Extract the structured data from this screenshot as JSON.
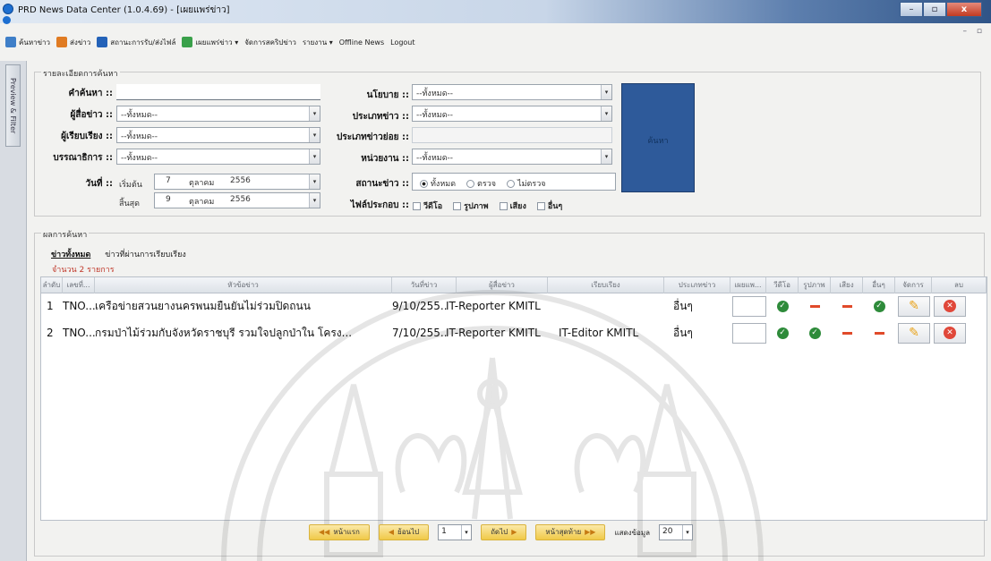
{
  "window": {
    "title": "PRD News Data Center (1.0.4.69) - [เผยแพร่ข่าว]",
    "minimize_icon": "minimize-icon",
    "maximize_icon": "maximize-icon",
    "close_label": "x"
  },
  "menu": {
    "items": [
      {
        "label": "ค้นหาข่าว",
        "icon": "search-news-icon",
        "color": "#3f7fc8"
      },
      {
        "label": "ส่งข่าว",
        "icon": "send-news-icon",
        "color": "#e07b22"
      },
      {
        "label": "สถานะการรับ/ส่งไฟล์",
        "icon": "info-icon",
        "color": "#2462b8"
      },
      {
        "label": "เผยแพร่ข่าว ▾",
        "icon": "publish-icon",
        "color": "#3aa04a"
      },
      {
        "label": "จัดการสคริปข่าว",
        "icon": "",
        "color": ""
      },
      {
        "label": "รายงาน ▾",
        "icon": "",
        "color": ""
      },
      {
        "label": "Offline News",
        "icon": "",
        "color": ""
      },
      {
        "label": "Logout",
        "icon": "",
        "color": ""
      }
    ]
  },
  "rail": {
    "tab_label": "Preview & Filter"
  },
  "criteria": {
    "legend": "รายละเอียดการค้นหา",
    "keyword_label": "คำค้นหา ::",
    "keyword_value": "",
    "reporter_label": "ผู้สื่อข่าว ::",
    "reporter_value": "--ทั้งหมด--",
    "writer_label": "ผู้เรียบเรียง ::",
    "writer_value": "--ทั้งหมด--",
    "editor_label": "บรรณาธิการ ::",
    "editor_value": "--ทั้งหมด--",
    "date_label": "วันที่ ::",
    "start_label": "เริ่มต้น",
    "start_day": "7",
    "start_month": "ตุลาคม",
    "start_year": "2556",
    "end_label": "สิ้นสุด",
    "end_day": "9",
    "end_month": "ตุลาคม",
    "end_year": "2556",
    "policy_label": "นโยบาย ::",
    "policy_value": "--ทั้งหมด--",
    "type_label": "ประเภทข่าว ::",
    "type_value": "--ทั้งหมด--",
    "subtype_label": "ประเภทข่าวย่อย ::",
    "subtype_value": "",
    "unit_label": "หน่วยงาน ::",
    "unit_value": "--ทั้งหมด--",
    "status_label": "สถานะข่าว ::",
    "status_options": [
      "ทั้งหมด",
      "ตรวจ",
      "ไม่ตรวจ"
    ],
    "attach_label": "ไฟล์ประกอบ ::",
    "attach_options": [
      "วีดีโอ",
      "รูปภาพ",
      "เสียง",
      "อื่นๆ"
    ],
    "search_button": "ค้นหา"
  },
  "results": {
    "legend": "ผลการค้นหา",
    "tabs": [
      "ข่าวทั้งหมด",
      "ข่าวที่ผ่านการเรียบเรียง"
    ],
    "count_text": "จำนวน 2 รายการ",
    "columns": [
      "ลำดับ",
      "เลขที่...",
      "หัวข้อข่าว",
      "วันที่ข่าว",
      "ผู้สื่อข่าว",
      "เรียบเรียง",
      "ประเภทข่าว",
      "เผยแพ...",
      "วีดีโอ",
      "รูปภาพ",
      "เสียง",
      "อื่นๆ",
      "จัดการ",
      "ลบ"
    ],
    "rows": [
      {
        "index": "1",
        "number": "TNO...",
        "title": "เครือข่ายสวนยางนครพนมยืนยันไม่ร่วมปิดถนน",
        "date": "9/10/255...",
        "reporter": "IT-Reporter KMITL",
        "editor": "",
        "type": "อื่นๆ",
        "video": "check",
        "image": "dash",
        "sound": "dash",
        "other": "check"
      },
      {
        "index": "2",
        "number": "TNO...",
        "title": "กรมป่าไม้ร่วมกับจังหวัดราชบุรี รวมใจปลูกป่าใน โครง...",
        "date": "7/10/255...",
        "reporter": "IT-Reporter KMITL",
        "editor": "IT-Editor KMITL",
        "type": "อื่นๆ",
        "video": "check",
        "image": "check",
        "sound": "dash",
        "other": "dash"
      }
    ]
  },
  "pager": {
    "first": "หน้าแรก",
    "prev": "ย้อนไป",
    "page": "1",
    "next": "ถัดไป",
    "last": "หน้าสุดท้าย",
    "show_label": "แสดงข้อมูล",
    "page_size": "20"
  }
}
